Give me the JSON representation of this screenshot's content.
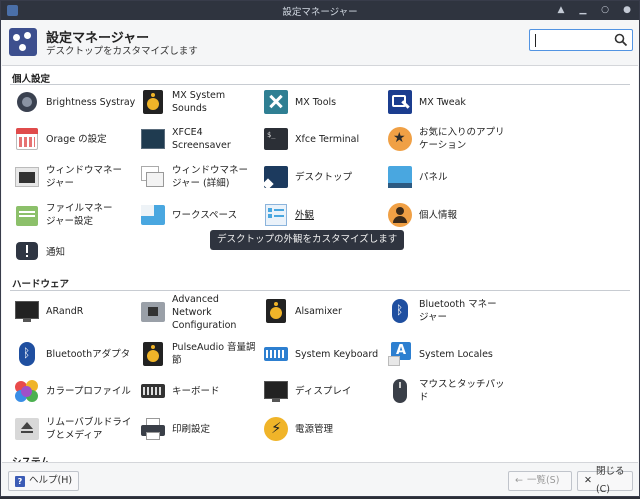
{
  "window": {
    "title": "設定マネージャー"
  },
  "header": {
    "title": "設定マネージャー",
    "subtitle": "デスクトップをカスタマイズします",
    "search_value": ""
  },
  "sections": {
    "personal": "個人設定",
    "hardware": "ハードウェア",
    "system": "システム"
  },
  "items": {
    "brightness": "Brightness Systray",
    "mx_system_sounds": "MX System Sounds",
    "mx_tools": "MX Tools",
    "mx_tweak": "MX Tweak",
    "orage_1": "Orage の設定",
    "screensaver": "XFCE4 Screensaver",
    "terminal": "Xfce Terminal",
    "favorites_1": "お気に入りのアプリ",
    "favorites_2": "ケーション",
    "wm_1": "ウィンドウマネー",
    "wm_2": "ジャー",
    "wmt_1": "ウィンドウマネー",
    "wmt_2": "ジャー (詳細)",
    "desktop": "デスクトップ",
    "panel": "パネル",
    "fm_1": "ファイルマネー",
    "fm_2": "ジャー設定",
    "workspaces": "ワークスペース",
    "appearance": "外観",
    "personal_info": "個人情報",
    "notifications": "通知",
    "arandr": "ARandR",
    "adv_net_1": "Advanced",
    "adv_net_2": "Network",
    "adv_net_3": "Configuration",
    "alsamixer": "Alsamixer",
    "bt_manager_1": "Bluetooth マネー",
    "bt_manager_2": "ジャー",
    "bt_adapter": "Bluetoothアダプタ",
    "pulse_1": "PulseAudio 音量調",
    "pulse_2": "節",
    "sys_keyboard": "System Keyboard",
    "sys_locales": "System Locales",
    "color_profile": "カラープロファイル",
    "keyboard": "キーボード",
    "display": "ディスプレイ",
    "mouse": "マウスとタッチパッド",
    "removable_1": "リムーバブルドライ",
    "removable_2": "ブとメディア",
    "printing": "印刷設定",
    "power": "電源管理"
  },
  "tooltip": "デスクトップの外観をカスタマイズします",
  "footer": {
    "help": "ヘルプ(H)",
    "all": "一覧(S)",
    "close": "閉じる(C)"
  },
  "icons": {
    "brightness": "brightness-icon",
    "sounds": "speaker-icon",
    "tools": "tools-icon",
    "tweak": "tweak-icon"
  },
  "colors": {
    "accent": "#5294e2",
    "titlebar": "#2f343f",
    "tooltip_bg": "#2f343f"
  }
}
